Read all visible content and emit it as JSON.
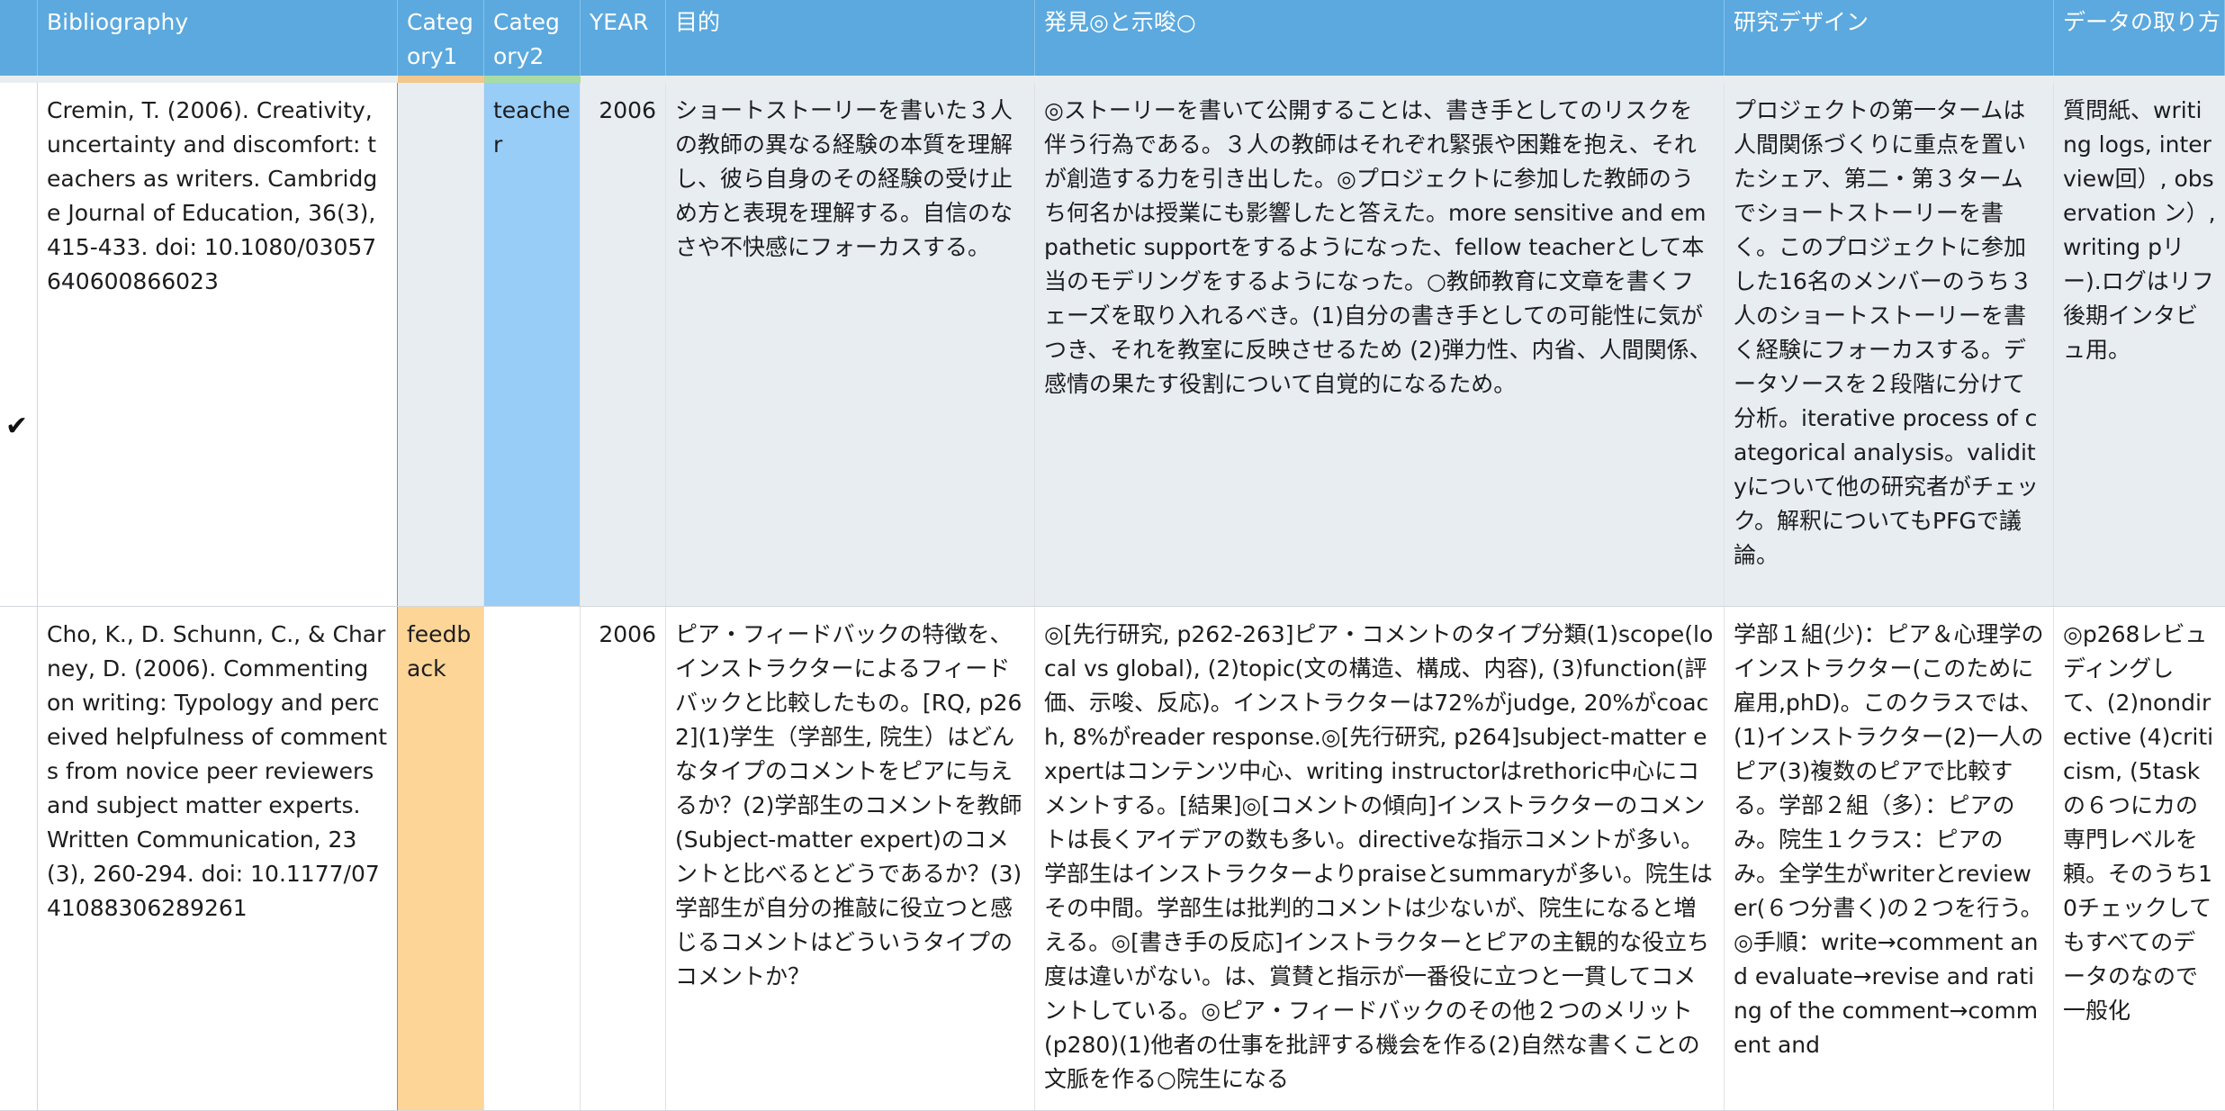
{
  "header": {
    "columns": [
      "",
      "Bibliography",
      "Category1",
      "Category2",
      "YEAR",
      "目的",
      "発見◎と示唆○",
      "研究デザイン",
      "データの取り方"
    ]
  },
  "colors": {
    "header_bg": "#5ba9de",
    "category1_feedback": "#fcd597",
    "category2_teacher": "#98cdf8",
    "row_shade": "#e8edf1"
  },
  "rows": [
    {
      "check": "✔",
      "bibliography": "Cremin, T. (2006). Creativity, uncertainty and discomfort: teachers as writers. Cambridge Journal of Education, 36(3), 415-433. doi: 10.1080/03057640600866023",
      "category1": "",
      "category2": "teacher",
      "year": "2006",
      "purpose": "ショートストーリーを書いた３人の教師の異なる経験の本質を理解し、彼ら自身のその経験の受け止め方と表現を理解する。自信のなさや不快感にフォーカスする。",
      "findings": "◎ストーリーを書いて公開することは、書き手としてのリスクを伴う行為である。３人の教師はそれぞれ緊張や困難を抱え、それが創造する力を引き出した。◎プロジェクトに参加した教師のうち何名かは授業にも影響したと答えた。more sensitive and empathetic supportをするようになった、fellow teacherとして本当のモデリングをするようになった。○教師教育に文章を書くフェーズを取り入れるべき。(1)自分の書き手としての可能性に気がつき、それを教室に反映させるため (2)弾力性、内省、人間関係、感情の果たす役割について自覚的になるため。",
      "design": "プロジェクトの第一タームは人間関係づくりに重点を置いたシェア、第二・第３タームでショートストーリーを書く。このプロジェクトに参加した16名のメンバーのうち３人のショートストーリーを書く経験にフォーカスする。データソースを２段階に分けて分析。iterative process of categorical analysis。validityについて他の研究者がチェック。解釈についてもPFGで議論。",
      "data": "質問紙、writing logs, interview回）, observation ン）, writing pリー).ログはリフ後期インタビュ用。"
    },
    {
      "check": "",
      "bibliography": "Cho, K., D. Schunn, C., & Charney, D. (2006). Commenting on writing: Typology and perceived helpfulness of comments from novice peer reviewers and subject matter experts. Written Communication, 23(3), 260-294. doi: 10.1177/0741088306289261",
      "category1": "feedback",
      "category2": "",
      "year": "2006",
      "purpose": "ピア・フィードバックの特徴を、インストラクターによるフィードバックと比較したもの。[RQ, p262](1)学生（学部生, 院生）はどんなタイプのコメントをピアに与えるか？(2)学部生のコメントを教師(Subject-matter expert)のコメントと比べるとどうであるか？(3)学部生が自分の推敲に役立つと感じるコメントはどういうタイプのコメントか？",
      "findings": "◎[先行研究, p262-263]ピア・コメントのタイプ分類(1)scope(local vs global), (2)topic(文の構造、構成、内容), (3)function(評価、示唆、反応)。インストラクターは72%がjudge, 20%がcoach, 8%がreader response.◎[先行研究, p264]subject-matter expertはコンテンツ中心、writing instructorはrethoric中心にコメントする。[結果]◎[コメントの傾向]インストラクターのコメントは長くアイデアの数も多い。directiveな指示コメントが多い。学部生はインストラクターよりpraiseとsummaryが多い。院生はその中間。学部生は批判的コメントは少ないが、院生になると増える。◎[書き手の反応]インストラクターとピアの主観的な役立ち度は違いがない。は、賞賛と指示が一番役に立つと一貫してコメントしている。◎ピア・フィードバックのその他２つのメリット(p280)(1)他者の仕事を批評する機会を作る(2)自然な書くことの文脈を作る○院生になる",
      "design": "学部１組(少)：ピア＆心理学のインストラクター(このために雇用,phD)。このクラスでは、(1)インストラクター(2)一人のピア(3)複数のピアで比較する。学部２組（多）：ピアのみ。院生１クラス：ピアのみ。全学生がwriterとreviewer(６つ分書く)の２つを行う。◎手順：write→comment and evaluate→revise and rating of the comment→comment and",
      "data": "◎p268レビュディングして、(2)nondirective (4)criticism, (5taskの６つにカの専門レベルを頼。そのうち10チェックしてもすべてのデータのなので一般化"
    }
  ]
}
